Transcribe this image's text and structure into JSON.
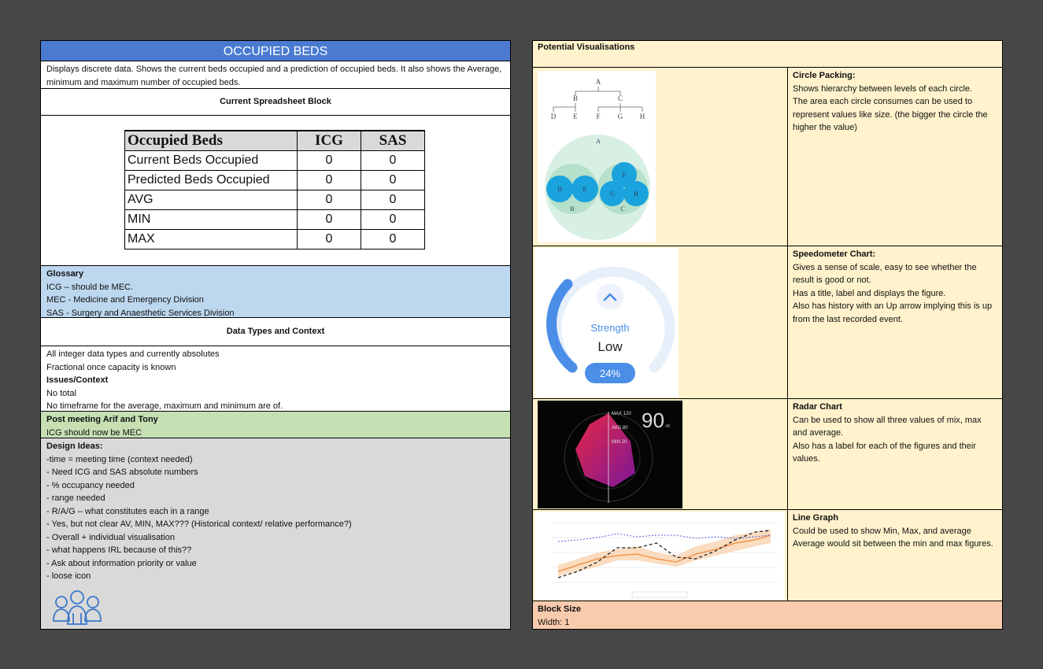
{
  "left": {
    "title": "OCCUPIED BEDS",
    "description": "Displays discrete data. Shows the current beds occupied and a prediction of occupied beds. It also shows the Average, minimum and maximum number of occupied beds.",
    "spreadsheet_heading": "Current Spreadsheet Block",
    "table": {
      "headers": [
        "Occupied Beds",
        "ICG",
        "SAS"
      ],
      "rows": [
        [
          "Current Beds Occupied",
          "0",
          "0"
        ],
        [
          "Predicted Beds Occupied",
          "0",
          "0"
        ],
        [
          "AVG",
          "0",
          "0"
        ],
        [
          "MIN",
          "0",
          "0"
        ],
        [
          "MAX",
          "0",
          "0"
        ]
      ]
    },
    "glossary": {
      "heading": "Glossary",
      "lines": [
        "ICG – should be MEC.",
        "MEC - Medicine and Emergency Division",
        "SAS - Surgery and Anaesthetic Services Division"
      ]
    },
    "data_types_heading": "Data Types and Context",
    "data_types": {
      "lines": [
        "All integer data types and currently absolutes",
        "Fractional once capacity is known"
      ],
      "issues_heading": "Issues/Context",
      "issues": [
        "No total",
        "No timeframe for the average, maximum and minimum are of."
      ]
    },
    "post_meeting": {
      "heading": "Post meeting Arif and Tony",
      "text": "ICG should now be MEC"
    },
    "design_ideas": {
      "heading": "Design Ideas:",
      "lines": [
        "-time = meeting time (context needed)",
        "- Need ICG and SAS absolute numbers",
        "- % occupancy needed",
        "- range needed",
        "- R/A/G – what constitutes each in a range",
        "- Yes, but not clear AV, MIN, MAX??? (Historical context/ relative performance?)",
        "- Overall + individual visualisation",
        "- what happens IRL because of this??",
        "- Ask about information priority or value",
        "- loose icon"
      ],
      "icon": "people-group-icon"
    }
  },
  "right": {
    "heading": "Potential Visualisations",
    "items": [
      {
        "title": "Circle Packing:",
        "lines": [
          "Shows hierarchy between levels of each circle.",
          "The area each circle consumes can be used to represent values like size. (the bigger the circle the higher the value)"
        ],
        "tree_labels": [
          "A",
          "B",
          "C",
          "D",
          "E",
          "F",
          "G",
          "H"
        ]
      },
      {
        "title": "Speedometer Chart:",
        "lines": [
          "Gives a sense of scale, easy to see whether the result is good or not.",
          "Has a title, label and displays the figure.",
          "Also has history with an Up arrow implying this is up from the last recorded event."
        ],
        "gauge": {
          "label": "Strength",
          "value_text": "Low",
          "percent": "24%",
          "fraction": 0.24
        }
      },
      {
        "title": "Radar Chart",
        "lines": [
          "Can be used to show all three values of mix, max and average.",
          "Also has a label for each of the figures and their values."
        ],
        "radar": {
          "max": "MAX 120",
          "avg": "AVG 80",
          "min": "MIN 20",
          "big_value": "90",
          "unit": "dB"
        }
      },
      {
        "title": "Line Graph",
        "lines": [
          "Could be used to show Min, Max, and average",
          "Average would sit between the min and max figures."
        ]
      }
    ],
    "block_size": {
      "heading": "Block Size",
      "text": "Width: 1"
    }
  },
  "colors": {
    "title_blue": "#4a7bd1",
    "glossary_blue": "#bdd7ee",
    "post_green": "#c6e0b4",
    "design_gray": "#d9d9d9",
    "vis_yellow": "#fff2cc",
    "block_orange": "#f8cbad"
  }
}
